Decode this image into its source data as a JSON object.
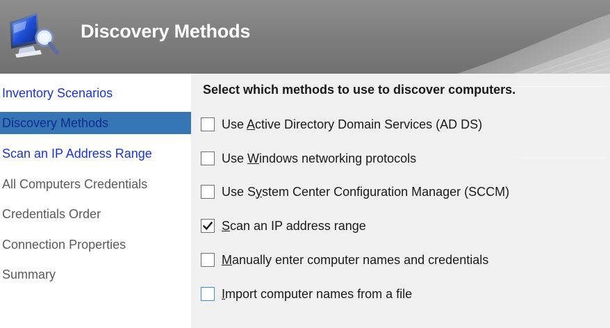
{
  "header": {
    "title": "Discovery Methods",
    "icon": "computer-monitor-magnifier-icon"
  },
  "sidebar": {
    "items": [
      {
        "label": "Inventory Scenarios",
        "state": "link"
      },
      {
        "label": "Discovery Methods",
        "state": "active"
      },
      {
        "label": "Scan an IP Address Range",
        "state": "link"
      },
      {
        "label": "All Computers Credentials",
        "state": "disabled"
      },
      {
        "label": "Credentials Order",
        "state": "disabled"
      },
      {
        "label": "Connection Properties",
        "state": "disabled"
      },
      {
        "label": "Summary",
        "state": "disabled"
      }
    ]
  },
  "main": {
    "heading": "Select which methods to use to discover computers.",
    "options": [
      {
        "pre": "Use ",
        "key": "A",
        "post": "ctive Directory Domain Services (AD DS)",
        "checked": false
      },
      {
        "pre": "Use ",
        "key": "W",
        "post": "indows networking protocols",
        "checked": false
      },
      {
        "pre": "Use ",
        "key": "y",
        "post": "stem Center Configuration Manager (SCCM)",
        "prefix_rest": "S",
        "checked": false
      },
      {
        "pre": "",
        "key": "S",
        "post": "can an IP address range",
        "checked": true
      },
      {
        "pre": "",
        "key": "M",
        "post": "anually enter computer names and credentials",
        "checked": false
      },
      {
        "pre": "",
        "key": "I",
        "post": "mport computer names from a file",
        "checked": false,
        "focused": true
      }
    ]
  },
  "colors": {
    "active_bg": "#3575b5",
    "link": "#1b33d6",
    "disabled": "#5a5a5a",
    "panel_bg": "#f0f0f0"
  }
}
